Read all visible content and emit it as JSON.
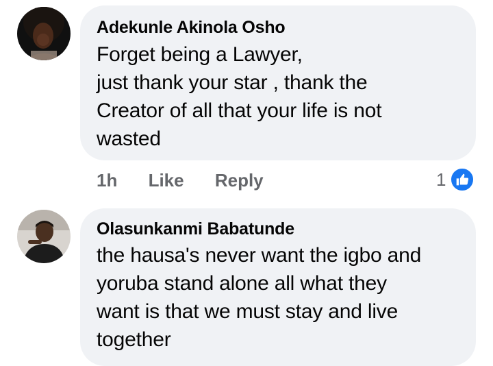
{
  "comments": [
    {
      "author": "Adekunle Akinola Osho",
      "lines": [
        "Forget being a Lawyer,",
        "just thank your star , thank the",
        "Creator of all that your life is not",
        "wasted"
      ],
      "time": "1h",
      "like_label": "Like",
      "reply_label": "Reply",
      "reaction_count": "1",
      "reaction_icon": "thumbs-up-icon",
      "reaction_color": "#1877f2"
    },
    {
      "author": "Olasunkanmi Babatunde",
      "lines": [
        "the hausa's never want the igbo and",
        "yoruba stand alone all what they",
        "want is that we must stay and live",
        "together"
      ]
    }
  ],
  "colors": {
    "bubble": "#f0f2f5",
    "meta_text": "#65676b",
    "body_text": "#050505"
  }
}
